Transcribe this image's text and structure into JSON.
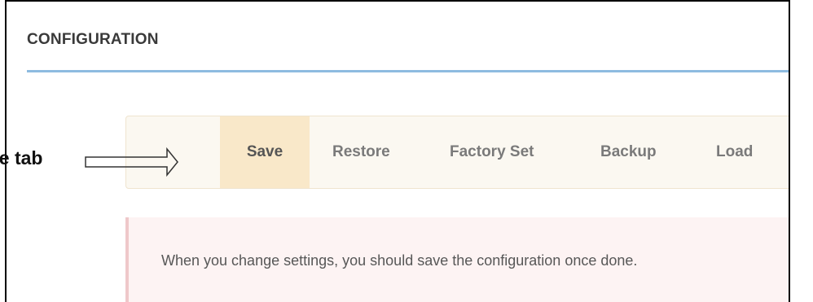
{
  "section": {
    "title": "CONFIGURATION"
  },
  "tabs": [
    {
      "label": "Save",
      "active": true
    },
    {
      "label": "Restore",
      "active": false
    },
    {
      "label": "Factory Set",
      "active": false
    },
    {
      "label": "Backup",
      "active": false
    },
    {
      "label": "Load",
      "active": false
    }
  ],
  "alert": {
    "message": "When you change settings, you should save the configuration once done."
  },
  "annotation": {
    "label": "ve tab",
    "arrow_icon": "right-arrow-icon"
  },
  "colors": {
    "title_underline": "#8dbbe0",
    "tabbar_background": "#fbf8f1",
    "active_tab_background": "#f9e8c9",
    "alert_background": "#fdf3f3",
    "alert_border": "#efc8ca"
  }
}
